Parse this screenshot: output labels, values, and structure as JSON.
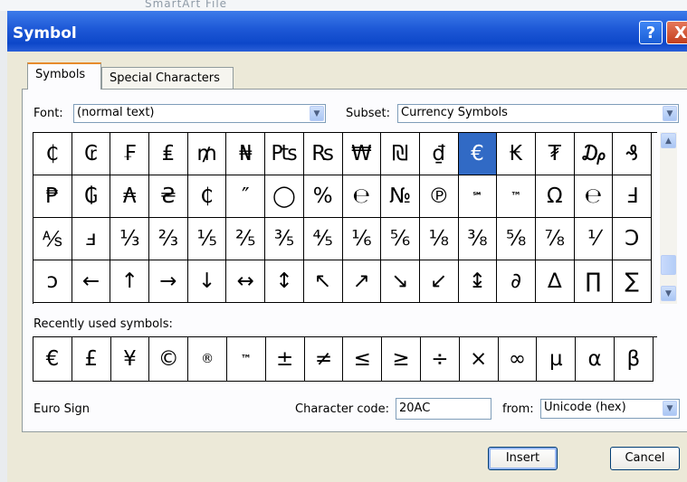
{
  "background": {
    "ribbon_text": "SmartArt  File"
  },
  "window": {
    "title": "Symbol",
    "help_label": "?",
    "close_label": "X"
  },
  "tabs": [
    {
      "label": "Symbols"
    },
    {
      "label": "Special Characters"
    }
  ],
  "font": {
    "label": "Font:",
    "value": "(normal text)"
  },
  "subset": {
    "label": "Subset:",
    "value": "Currency Symbols"
  },
  "symbols": [
    "₵",
    "₢",
    "₣",
    "₤",
    "₥",
    "₦",
    "₧",
    "₨",
    "₩",
    "₪",
    "₫",
    "€",
    "₭",
    "₮",
    "₯",
    "₰",
    "₱",
    "₲",
    "₳",
    "₴",
    "₵",
    "″",
    "◯",
    "%",
    "℮",
    "№",
    "℗",
    "℠",
    "™",
    "Ω",
    "℮",
    "Ⅎ",
    "⅍",
    "ⅎ",
    "⅓",
    "⅔",
    "⅕",
    "⅖",
    "⅗",
    "⅘",
    "⅙",
    "⅚",
    "⅛",
    "⅜",
    "⅝",
    "⅞",
    "⅟",
    "Ↄ",
    "ↄ",
    "←",
    "↑",
    "→",
    "↓",
    "↔",
    "↕",
    "↖",
    "↗",
    "↘",
    "↙",
    "↨",
    "∂",
    "∆",
    "∏",
    "∑"
  ],
  "selected_symbol_index": 11,
  "recent": {
    "label": "Recently used symbols:",
    "symbols": [
      "€",
      "£",
      "¥",
      "©",
      "®",
      "™",
      "±",
      "≠",
      "≤",
      "≥",
      "÷",
      "×",
      "∞",
      "µ",
      "α",
      "β"
    ]
  },
  "status": {
    "character_name": "Euro Sign",
    "character_code_label": "Character code:",
    "character_code": "20AC",
    "from_label": "from:",
    "from_value": "Unicode (hex)"
  },
  "buttons": {
    "insert": "Insert",
    "cancel": "Cancel"
  },
  "colors": {
    "title_bar": "#0d47c9",
    "selected": "#316ac5",
    "dialog_bg": "#ece9d8"
  }
}
